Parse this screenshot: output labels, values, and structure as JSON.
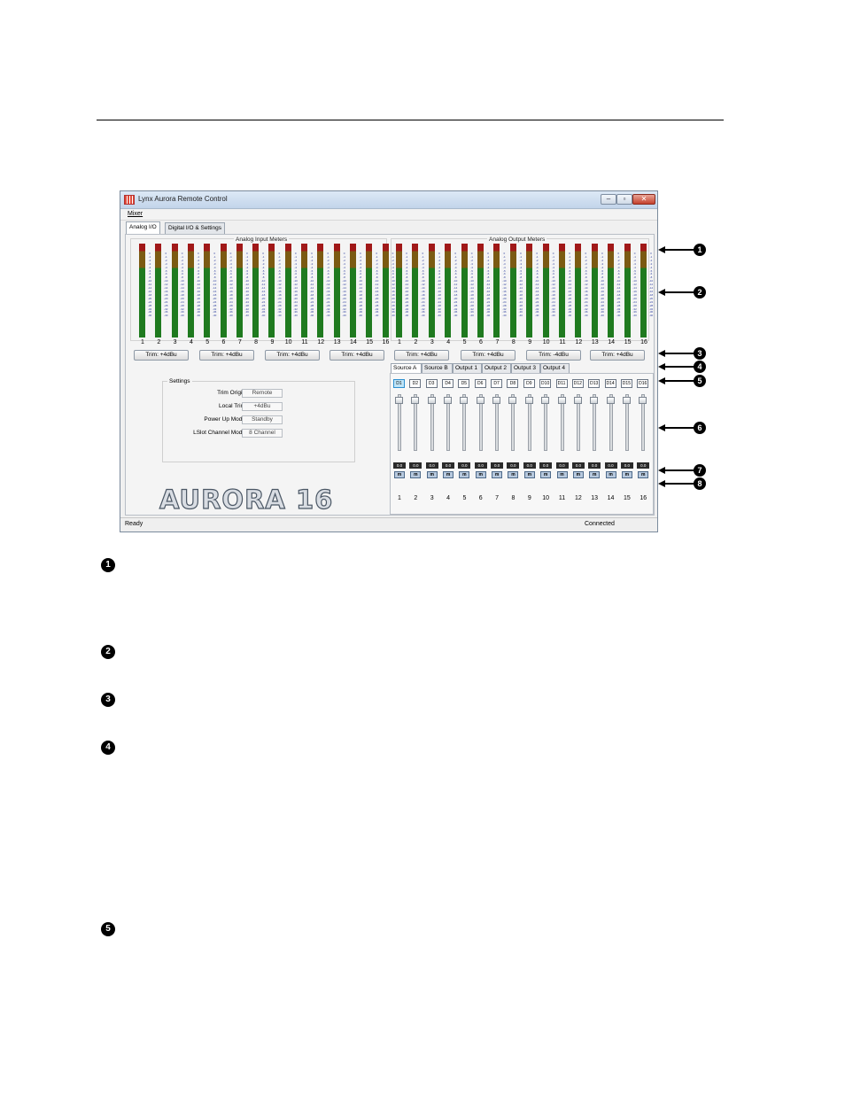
{
  "window": {
    "title": "Lynx Aurora Remote Control",
    "controls": {
      "minimize": "–",
      "maximize": "▫",
      "close": "✕"
    }
  },
  "menu": {
    "mixer": "Mixer"
  },
  "tabs": [
    "Analog I/O",
    "Digital I/O & Settings"
  ],
  "input_meters": {
    "title": "Analog Input Meters",
    "channels": [
      "1",
      "2",
      "3",
      "4",
      "5",
      "6",
      "7",
      "8",
      "9",
      "10",
      "11",
      "12",
      "13",
      "14",
      "15",
      "16"
    ]
  },
  "output_meters": {
    "title": "Analog Output Meters",
    "channels": [
      "1",
      "2",
      "3",
      "4",
      "5",
      "6",
      "7",
      "8",
      "9",
      "10",
      "11",
      "12",
      "13",
      "14",
      "15",
      "16"
    ]
  },
  "meter_scale": [
    "0",
    "-1",
    "-2",
    "-3",
    "-4",
    "-5",
    "-6",
    "-8",
    "-10",
    "-12",
    "-14",
    "-16",
    "-18",
    "-20",
    "-24",
    "-28",
    "-32",
    "-36",
    "-40"
  ],
  "trim_buttons": [
    "Trim: +4dBu",
    "Trim: +4dBu",
    "Trim: +4dBu",
    "Trim: +4dBu",
    "Trim: +4dBu",
    "Trim: +4dBu",
    "Trim: -4dBu",
    "Trim: +4dBu"
  ],
  "settings": {
    "title": "Settings",
    "rows": [
      {
        "label": "Trim Origin",
        "value": "Remote"
      },
      {
        "label": "Local Trim",
        "value": "+4dBu"
      },
      {
        "label": "Power Up Mode",
        "value": "Standby"
      },
      {
        "label": "LSlot Channel Mode",
        "value": "8 Channel"
      }
    ]
  },
  "logo": "AURORA 16",
  "mixer_tabs": [
    "Source A",
    "Source B",
    "Output 1",
    "Output 2",
    "Output 3",
    "Output 4"
  ],
  "mixer_strips": {
    "sources": [
      "D1",
      "D2",
      "D3",
      "D4",
      "D5",
      "D6",
      "D7",
      "D8",
      "D9",
      "D10",
      "D11",
      "D12",
      "D13",
      "D14",
      "D15",
      "D16"
    ],
    "gains": [
      "0.0",
      "0.0",
      "0.0",
      "0.0",
      "0.0",
      "0.0",
      "0.0",
      "0.0",
      "0.0",
      "0.0",
      "0.0",
      "0.0",
      "0.0",
      "0.0",
      "0.0",
      "0.0"
    ],
    "mute_label": "m",
    "numbers": [
      "1",
      "2",
      "3",
      "4",
      "5",
      "6",
      "7",
      "8",
      "9",
      "10",
      "11",
      "12",
      "13",
      "14",
      "15",
      "16"
    ],
    "fader_level": 0.95
  },
  "status": {
    "left": "Ready",
    "right": "Connected"
  },
  "callouts": [
    "1",
    "2",
    "3",
    "4",
    "5",
    "6",
    "7",
    "8"
  ],
  "notes": [
    "1",
    "2",
    "3",
    "4",
    "5"
  ]
}
